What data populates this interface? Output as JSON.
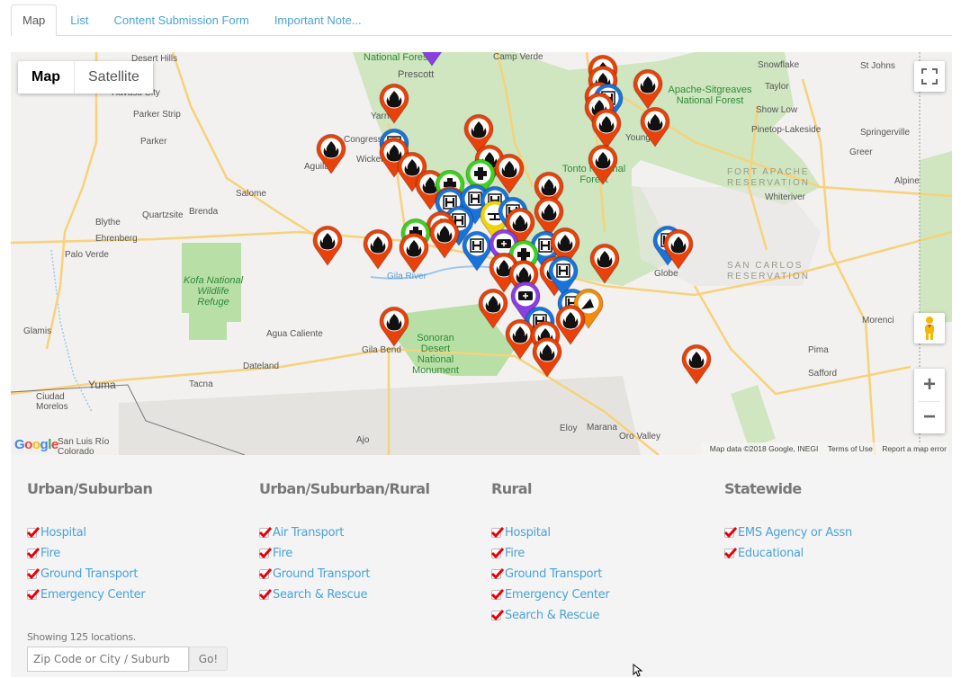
{
  "tabs": [
    {
      "label": "Map",
      "active": true
    },
    {
      "label": "List",
      "active": false
    },
    {
      "label": "Content Submission Form",
      "active": false
    },
    {
      "label": "Important Note...",
      "active": false
    }
  ],
  "map": {
    "type_controls": {
      "map_label": "Map",
      "satellite_label": "Satellite",
      "selected": "Map"
    },
    "attribution": {
      "data": "Map data ©2018 Google, INEGI",
      "terms": "Terms of Use",
      "report": "Report a map error"
    },
    "logo": "Google",
    "icons": {
      "fullscreen": "fullscreen-icon",
      "pegman": "street-view-pegman-icon",
      "zoom_in": "+",
      "zoom_out": "−"
    },
    "place_labels": [
      {
        "text": "Desert Hills"
      },
      {
        "text": "Havasu City"
      },
      {
        "text": "Parker Strip"
      },
      {
        "text": "Parker"
      },
      {
        "text": "Salome"
      },
      {
        "text": "Brenda"
      },
      {
        "text": "Quartzsite"
      },
      {
        "text": "Blythe"
      },
      {
        "text": "Ehrenberg"
      },
      {
        "text": "Palo Verde"
      },
      {
        "text": "Glamis"
      },
      {
        "text": "Yuma"
      },
      {
        "text": "Ciudad Morelos"
      },
      {
        "text": "San Luis Río Colorado"
      },
      {
        "text": "Tacna"
      },
      {
        "text": "Dateland"
      },
      {
        "text": "Agua Caliente"
      },
      {
        "text": "Gila Bend"
      },
      {
        "text": "Ajo"
      },
      {
        "text": "Prescott"
      },
      {
        "text": "Camp Verde"
      },
      {
        "text": "Snowflake"
      },
      {
        "text": "St Johns"
      },
      {
        "text": "Taylor"
      },
      {
        "text": "Show Low"
      },
      {
        "text": "Pinetop-Lakeside"
      },
      {
        "text": "Springerville"
      },
      {
        "text": "Greer"
      },
      {
        "text": "Alpine"
      },
      {
        "text": "Whiteriver"
      },
      {
        "text": "Globe"
      },
      {
        "text": "Morenci"
      },
      {
        "text": "Pima"
      },
      {
        "text": "Safford"
      },
      {
        "text": "Eloy"
      },
      {
        "text": "Marana"
      },
      {
        "text": "Oro Valley"
      },
      {
        "text": "Young"
      },
      {
        "text": "Congress"
      },
      {
        "text": "Aguila"
      },
      {
        "text": "Yarnell"
      },
      {
        "text": "Wickenburg"
      }
    ],
    "area_labels": [
      {
        "text": "National Forest"
      },
      {
        "text": "Apache-Sitgreaves National Forest"
      },
      {
        "text": "Tonto National Forest"
      },
      {
        "text": "Kofa National Wildlife Refuge"
      },
      {
        "text": "Sonoran Desert National Monument"
      },
      {
        "text": "FORT APACHE RESERVATION"
      },
      {
        "text": "SAN CARLOS RESERVATION"
      },
      {
        "text": "Gila River"
      }
    ],
    "marker_types": {
      "fire": {
        "color": "#e8420a",
        "icon": "fire-icon"
      },
      "hospital": {
        "color": "#1a73d8",
        "icon": "hospital-h-icon"
      },
      "emergency": {
        "color": "#3fcf1e",
        "icon": "medical-cross-icon"
      },
      "ground": {
        "color": "#8b3fe0",
        "icon": "ambulance-icon"
      },
      "search": {
        "color": "#f28c0c",
        "icon": "search-rescue-icon"
      },
      "air": {
        "color": "#f2d20c",
        "icon": "helicopter-icon"
      }
    }
  },
  "filters": {
    "columns": [
      {
        "title": "Urban/Suburban",
        "items": [
          {
            "label": "Hospital",
            "checked": true
          },
          {
            "label": "Fire",
            "checked": true
          },
          {
            "label": "Ground Transport",
            "checked": true
          },
          {
            "label": "Emergency Center",
            "checked": true
          }
        ]
      },
      {
        "title": "Urban/Suburban/Rural",
        "items": [
          {
            "label": "Air Transport",
            "checked": true
          },
          {
            "label": "Fire",
            "checked": true
          },
          {
            "label": "Ground Transport",
            "checked": true
          },
          {
            "label": "Search & Rescue",
            "checked": true
          }
        ]
      },
      {
        "title": "Rural",
        "items": [
          {
            "label": "Hospital",
            "checked": true
          },
          {
            "label": "Fire",
            "checked": true
          },
          {
            "label": "Ground Transport",
            "checked": true
          },
          {
            "label": "Emergency Center",
            "checked": true
          },
          {
            "label": "Search & Rescue",
            "checked": true
          }
        ]
      },
      {
        "title": "Statewide",
        "items": [
          {
            "label": "EMS Agency or Assn",
            "checked": true
          },
          {
            "label": "Educational",
            "checked": true
          }
        ]
      }
    ],
    "showing_text": "Showing 125 locations.",
    "search": {
      "placeholder": "Zip Code or City / Suburb",
      "value": ""
    },
    "go_label": "Go!"
  },
  "colors": {
    "link": "#4aa3d8",
    "check": "#e8000b",
    "fire_marker": "#e8420a",
    "hospital_marker": "#1a73d8"
  }
}
